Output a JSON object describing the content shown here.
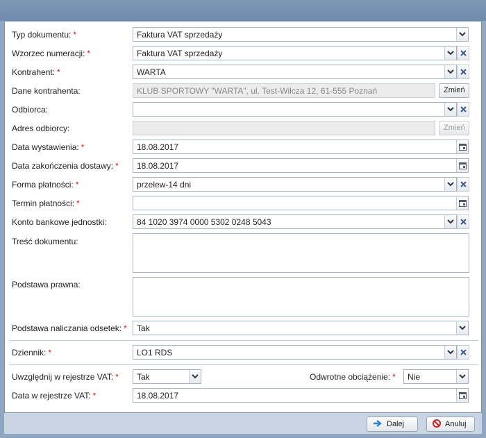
{
  "form": {
    "typ_dokumentu": {
      "label": "Typ dokumentu:",
      "value": "Faktura VAT sprzedaży"
    },
    "wzorzec_numeracji": {
      "label": "Wzorzec numeracji:",
      "value": "Faktura VAT sprzedaży"
    },
    "kontrahent": {
      "label": "Kontrahent:",
      "value": "WARTA"
    },
    "dane_kontrahenta": {
      "label": "Dane kontrahenta:",
      "value": "KLUB SPORTOWY \"WARTA\", ul. Test-Wilcza 12, 61-555 Poznań",
      "button": "Zmień"
    },
    "odbiorca": {
      "label": "Odbiorca:",
      "value": ""
    },
    "adres_odbiorcy": {
      "label": "Adres odbiorcy:",
      "value": "",
      "button": "Zmień"
    },
    "data_wystawienia": {
      "label": "Data wystawienia:",
      "value": "18.08.2017"
    },
    "data_zakonczenia": {
      "label": "Data zakończenia dostawy:",
      "value": "18.08.2017"
    },
    "forma_platnosci": {
      "label": "Forma płatności:",
      "value": "przelew-14 dni"
    },
    "termin_platnosci": {
      "label": "Termin płatności:",
      "value": ""
    },
    "konto_bankowe": {
      "label": "Konto bankowe jednostki:",
      "value": "84 1020 3974 0000 5302 0248 5043"
    },
    "tresc_dokumentu": {
      "label": "Treść dokumentu:",
      "value": ""
    },
    "podstawa_prawna": {
      "label": "Podstawa prawna:",
      "value": ""
    },
    "podstawa_odsetek": {
      "label": "Podstawa naliczania odsetek:",
      "value": "Tak"
    },
    "dziennik": {
      "label": "Dziennik:",
      "value": "LO1 RDS"
    },
    "uwzglednij_vat": {
      "label": "Uwzględnij w rejestrze VAT:",
      "value": "Tak"
    },
    "odwrotne_obciazenie": {
      "label": "Odwrotne obciążenie:",
      "value": "Nie"
    },
    "data_rejestr_vat": {
      "label": "Data w rejestrze VAT:",
      "value": "18.08.2017"
    },
    "required_mark": "*"
  },
  "footer": {
    "next_label": "Dalej",
    "cancel_label": "Anuluj"
  },
  "icons": {
    "dropdown": "chevron-down-icon",
    "clear": "close-icon",
    "calendar": "calendar-icon",
    "next": "arrow-right-icon",
    "cancel": "no-entry-icon"
  },
  "colors": {
    "required": "#dd1111",
    "chrome": "#8ea6c0",
    "footer": "#c9d5e2"
  }
}
